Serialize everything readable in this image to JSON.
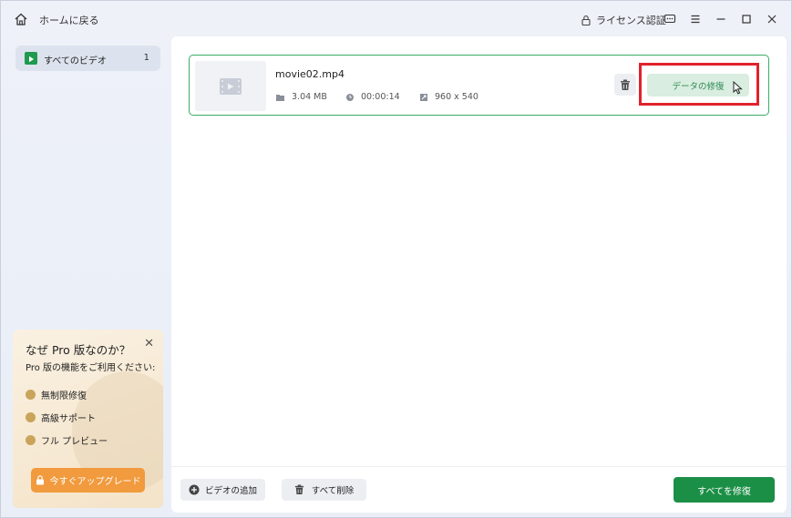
{
  "titlebar": {
    "home_label": "ホームに戻る",
    "license_label": "ライセンス認証"
  },
  "sidebar": {
    "items": [
      {
        "label": "すべてのビデオ",
        "count": "1"
      }
    ]
  },
  "promo": {
    "title": "なぜ Pro 版なのか？",
    "subtitle": "Pro 版の機能をご利用ください:",
    "features": [
      "無制限修復",
      "高級サポート",
      "フル プレビュー"
    ],
    "upgrade_label": "今すぐアップグレード"
  },
  "file": {
    "name": "movie02.mp4",
    "size": "3.04 MB",
    "duration": "00:00:14",
    "resolution": "960 x 540",
    "repair_label": "データの修復"
  },
  "footer": {
    "add_label": "ビデオの追加",
    "delete_all_label": "すべて削除",
    "repair_all_label": "すべてを修復"
  },
  "colors": {
    "accent_green": "#1c8f46",
    "highlight_red": "#e0222b",
    "upgrade_orange": "#f19a3e"
  }
}
